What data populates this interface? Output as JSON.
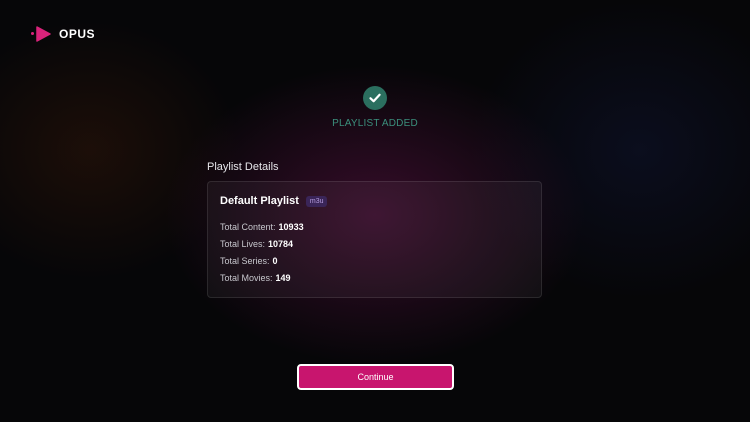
{
  "app": {
    "name": "OPUS"
  },
  "status": {
    "message": "PLAYLIST ADDED",
    "icon": "check-circle-icon",
    "color": "#2b6f5f"
  },
  "details": {
    "section_title": "Playlist Details",
    "playlist_name": "Default Playlist",
    "format_badge": "m3u",
    "stats": [
      {
        "label": "Total Content:",
        "value": "10933"
      },
      {
        "label": "Total Lives:",
        "value": "10784"
      },
      {
        "label": "Total Series:",
        "value": "0"
      },
      {
        "label": "Total Movies:",
        "value": "149"
      }
    ]
  },
  "actions": {
    "continue_label": "Continue",
    "continue_color": "#c8156e"
  }
}
